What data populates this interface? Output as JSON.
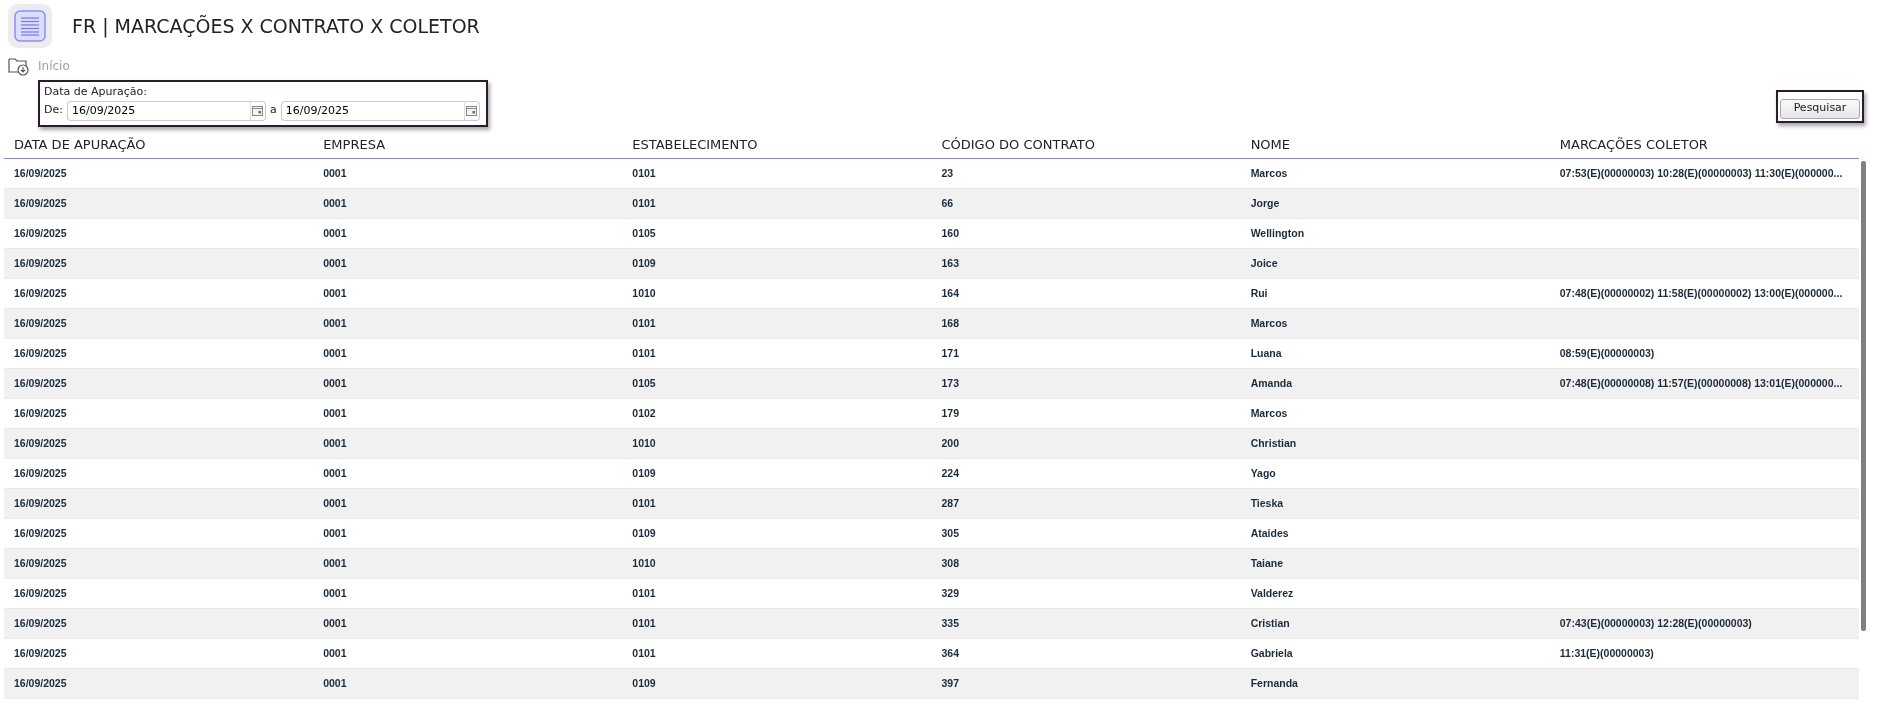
{
  "page": {
    "title": "FR | MARCAÇÕES X CONTRATO X COLETOR"
  },
  "breadcrumb": [
    {
      "label": "Início"
    }
  ],
  "filter": {
    "label": "Data de Apuração:",
    "from_label": "De:",
    "from_value": "16/09/2025",
    "to_label": "a",
    "to_value": "16/09/2025"
  },
  "search_button": "Pesquisar",
  "table": {
    "columns": [
      "DATA DE APURAÇÃO",
      "EMPRESA",
      "ESTABELECIMENTO",
      "CÓDIGO DO CONTRATO",
      "NOME",
      "MARCAÇÕES COLETOR"
    ],
    "rows": [
      [
        "16/09/2025",
        "0001",
        "0101",
        "23",
        "Marcos",
        "07:53(E)(00000003) 10:28(E)(00000003) 11:30(E)(000000..."
      ],
      [
        "16/09/2025",
        "0001",
        "0101",
        "66",
        "Jorge",
        null
      ],
      [
        "16/09/2025",
        "0001",
        "0105",
        "160",
        "Wellington",
        null
      ],
      [
        "16/09/2025",
        "0001",
        "0109",
        "163",
        "Joice",
        null
      ],
      [
        "16/09/2025",
        "0001",
        "1010",
        "164",
        "Rui",
        "07:48(E)(00000002) 11:58(E)(00000002) 13:00(E)(000000..."
      ],
      [
        "16/09/2025",
        "0001",
        "0101",
        "168",
        "Marcos",
        null
      ],
      [
        "16/09/2025",
        "0001",
        "0101",
        "171",
        "Luana",
        "08:59(E)(00000003)"
      ],
      [
        "16/09/2025",
        "0001",
        "0105",
        "173",
        "Amanda",
        "07:48(E)(00000008) 11:57(E)(00000008) 13:01(E)(000000..."
      ],
      [
        "16/09/2025",
        "0001",
        "0102",
        "179",
        "Marcos",
        null
      ],
      [
        "16/09/2025",
        "0001",
        "1010",
        "200",
        "Christian",
        null
      ],
      [
        "16/09/2025",
        "0001",
        "0109",
        "224",
        "Yago",
        null
      ],
      [
        "16/09/2025",
        "0001",
        "0101",
        "287",
        "Tieska",
        null
      ],
      [
        "16/09/2025",
        "0001",
        "0109",
        "305",
        "Ataides",
        null
      ],
      [
        "16/09/2025",
        "0001",
        "1010",
        "308",
        "Taiane",
        null
      ],
      [
        "16/09/2025",
        "0001",
        "0101",
        "329",
        "Valderez",
        null
      ],
      [
        "16/09/2025",
        "0001",
        "0101",
        "335",
        "Cristian",
        "07:43(E)(00000003) 12:28(E)(00000003)"
      ],
      [
        "16/09/2025",
        "0001",
        "0101",
        "364",
        "Gabriela",
        "11:31(E)(00000003)"
      ],
      [
        "16/09/2025",
        "0001",
        "0109",
        "397",
        "Fernanda",
        null
      ]
    ]
  }
}
